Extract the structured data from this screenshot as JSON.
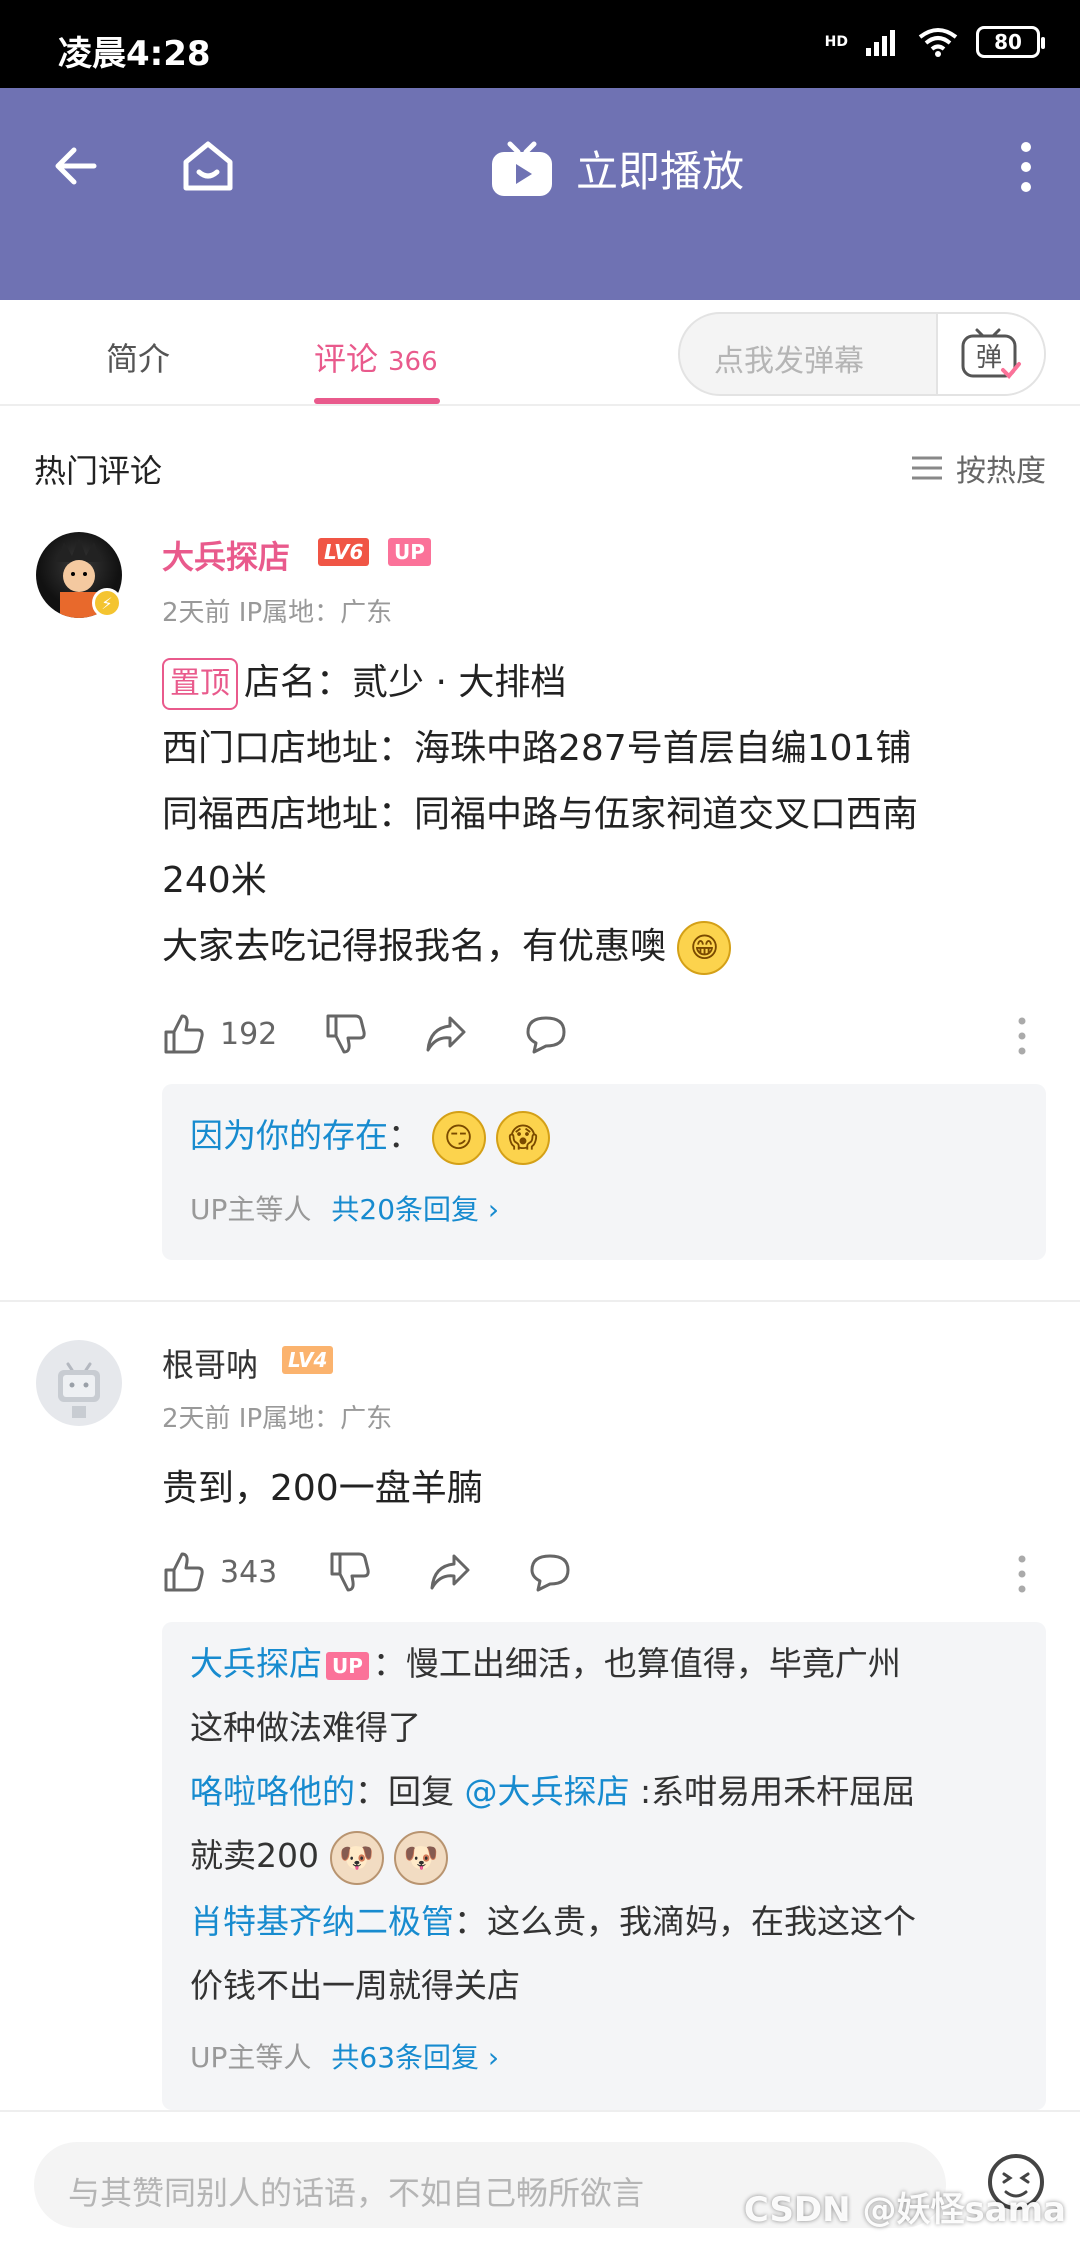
{
  "status_bar": {
    "time": "凌晨4:28",
    "network": "HD",
    "battery": "80"
  },
  "nav": {
    "play_label": "立即播放"
  },
  "tabs": {
    "intro": "简介",
    "comments": "评论",
    "comments_count": "366",
    "danmaku_placeholder": "点我发弹幕",
    "danmaku_btn": "弹"
  },
  "hot": {
    "title": "热门评论",
    "sort": "按热度"
  },
  "comments": [
    {
      "username": "大兵探店",
      "level": "LV6",
      "up_badge": "UP",
      "meta": "2天前  IP属地：广东",
      "pin": "置顶",
      "lines": [
        "店名：贰少 · 大排档",
        "西门口店地址：海珠中路287号首层自编101铺",
        "同福西店地址：同福中路与伍家祠道交叉口西南",
        "240米",
        "大家去吃记得报我名，有优惠噢"
      ],
      "likes": "192",
      "replies": [
        {
          "user": "因为你的存在",
          "text": "："
        }
      ],
      "reply_footer": "UP主等人",
      "reply_more": "共20条回复 ›"
    },
    {
      "username": "根哥呐",
      "level": "LV4",
      "meta": "2天前  IP属地：广东",
      "lines": [
        "贵到，200一盘羊腩"
      ],
      "likes": "343",
      "replies": [
        {
          "user": "大兵探店",
          "up": "UP",
          "text": "：慢工出细活，也算值得，毕竟广州",
          "text2": "这种做法难得了"
        },
        {
          "user": "咯啦咯他的",
          "text": "：回复 ",
          "mention": "@大兵探店",
          "text_after": " :系咁易用禾杆屈屈",
          "text2": "就卖200"
        },
        {
          "user": "肖特基齐纳二极管",
          "text": "：这么贵，我滴妈，在我这这个",
          "text2": "价钱不出一周就得关店"
        }
      ],
      "reply_footer": "UP主等人",
      "reply_more": "共63条回复 ›"
    }
  ],
  "input": {
    "placeholder": "与其赞同别人的话语，不如自己畅所欲言",
    "watermark": "CSDN @妖怪sama"
  },
  "colors": {
    "nav": "#6f72b3",
    "accent_pink": "#e95a8c",
    "link_blue": "#178bcf"
  },
  "icons": [
    "back-arrow-icon",
    "home-icon",
    "tv-play-icon",
    "more-vertical-icon",
    "like-icon",
    "dislike-icon",
    "share-icon",
    "reply-icon",
    "sort-icon",
    "emoji-icon"
  ]
}
